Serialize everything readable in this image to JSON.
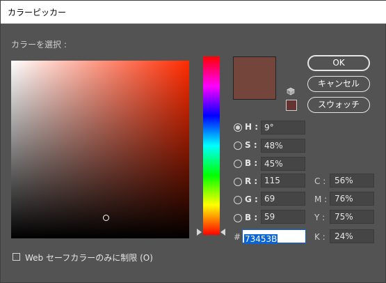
{
  "window": {
    "title": "カラーピッカー"
  },
  "picker": {
    "select_label": "カラーを選択 :"
  },
  "buttons": {
    "ok": "OK",
    "cancel": "キャンセル",
    "swatches": "スウォッチ"
  },
  "hsb": {
    "h": {
      "label": "H :",
      "value": "9°",
      "checked": true
    },
    "s": {
      "label": "S :",
      "value": "48%"
    },
    "b": {
      "label": "B :",
      "value": "45%"
    }
  },
  "rgb": {
    "r": {
      "label": "R :",
      "value": "115"
    },
    "g": {
      "label": "G :",
      "value": "69"
    },
    "b": {
      "label": "B :",
      "value": "59"
    }
  },
  "cmyk": {
    "c": {
      "label": "C :",
      "value": "56%"
    },
    "m": {
      "label": "M :",
      "value": "76%"
    },
    "y": {
      "label": "Y :",
      "value": "75%"
    },
    "k": {
      "label": "K :",
      "value": "24%"
    }
  },
  "hex": {
    "label": "#",
    "value": "73453B"
  },
  "web_only": {
    "label": "Web セーフカラーのみに制限 (O)",
    "checked": false
  },
  "colors": {
    "current": "#73453b",
    "web_safe": "#663333",
    "hue_base": "#ff2b00"
  },
  "icons": {
    "out_of_web_gamut": "cube-icon"
  }
}
